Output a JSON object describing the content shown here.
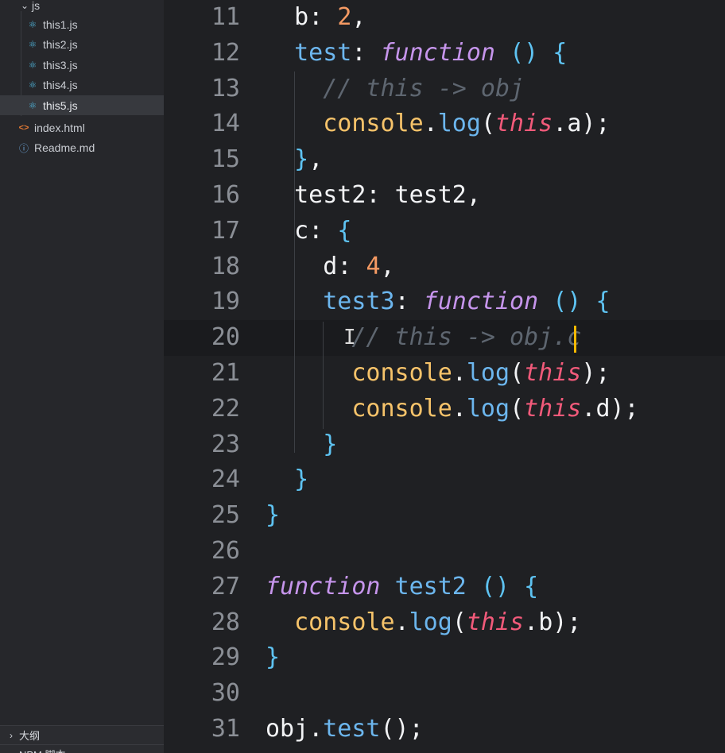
{
  "sidebar": {
    "folder": {
      "label": "js"
    },
    "files": [
      {
        "label": "this1.js",
        "icon": "react-icon",
        "active": false
      },
      {
        "label": "this2.js",
        "icon": "react-icon",
        "active": false
      },
      {
        "label": "this3.js",
        "icon": "react-icon",
        "active": false
      },
      {
        "label": "this4.js",
        "icon": "react-icon",
        "active": false
      },
      {
        "label": "this5.js",
        "icon": "react-icon",
        "active": true
      }
    ],
    "root_files": [
      {
        "label": "index.html",
        "icon": "html-icon"
      },
      {
        "label": "Readme.md",
        "icon": "info-icon"
      }
    ],
    "panels": [
      {
        "label": "大纲"
      },
      {
        "label": "NPM 脚本"
      }
    ]
  },
  "editor": {
    "current_line": 20,
    "lines": [
      {
        "num": "11",
        "tokens": [
          [
            "k",
            "  b"
          ],
          [
            "p",
            ": "
          ],
          [
            "n",
            "2"
          ],
          [
            "p",
            ","
          ]
        ]
      },
      {
        "num": "12",
        "tokens": [
          [
            "b",
            "  test"
          ],
          [
            "p",
            ": "
          ],
          [
            "f",
            "function"
          ],
          [
            "p",
            " "
          ],
          [
            "br",
            "()"
          ],
          [
            "p",
            " "
          ],
          [
            "br",
            "{"
          ]
        ]
      },
      {
        "num": "13",
        "tokens": [
          [
            "c",
            "    // this -> obj"
          ]
        ]
      },
      {
        "num": "14",
        "tokens": [
          [
            "o",
            "    console"
          ],
          [
            "p",
            "."
          ],
          [
            "b",
            "log"
          ],
          [
            "p",
            "("
          ],
          [
            "t",
            "this"
          ],
          [
            "p",
            "."
          ],
          [
            "k",
            "a"
          ],
          [
            "p",
            ");"
          ]
        ]
      },
      {
        "num": "15",
        "tokens": [
          [
            "br",
            "  }"
          ],
          [
            "p",
            ","
          ]
        ]
      },
      {
        "num": "16",
        "tokens": [
          [
            "k",
            "  test2"
          ],
          [
            "p",
            ": "
          ],
          [
            "k",
            "test2"
          ],
          [
            "p",
            ","
          ]
        ]
      },
      {
        "num": "17",
        "tokens": [
          [
            "k",
            "  c"
          ],
          [
            "p",
            ": "
          ],
          [
            "br",
            "{"
          ]
        ]
      },
      {
        "num": "18",
        "tokens": [
          [
            "k",
            "    d"
          ],
          [
            "p",
            ": "
          ],
          [
            "n",
            "4"
          ],
          [
            "p",
            ","
          ]
        ]
      },
      {
        "num": "19",
        "tokens": [
          [
            "b",
            "    test3"
          ],
          [
            "p",
            ": "
          ],
          [
            "f",
            "function"
          ],
          [
            "p",
            " "
          ],
          [
            "br",
            "()"
          ],
          [
            "p",
            " "
          ],
          [
            "br",
            "{"
          ]
        ]
      },
      {
        "num": "20",
        "tokens": [
          [
            "c",
            "      // this -> obj.c"
          ]
        ]
      },
      {
        "num": "21",
        "tokens": [
          [
            "o",
            "      console"
          ],
          [
            "p",
            "."
          ],
          [
            "b",
            "log"
          ],
          [
            "p",
            "("
          ],
          [
            "t",
            "this"
          ],
          [
            "p",
            ");"
          ]
        ]
      },
      {
        "num": "22",
        "tokens": [
          [
            "o",
            "      console"
          ],
          [
            "p",
            "."
          ],
          [
            "b",
            "log"
          ],
          [
            "p",
            "("
          ],
          [
            "t",
            "this"
          ],
          [
            "p",
            "."
          ],
          [
            "k",
            "d"
          ],
          [
            "p",
            ");"
          ]
        ]
      },
      {
        "num": "23",
        "tokens": [
          [
            "br",
            "    }"
          ]
        ]
      },
      {
        "num": "24",
        "tokens": [
          [
            "br",
            "  }"
          ]
        ]
      },
      {
        "num": "25",
        "tokens": [
          [
            "br",
            "}"
          ]
        ]
      },
      {
        "num": "26",
        "tokens": []
      },
      {
        "num": "27",
        "tokens": [
          [
            "f",
            "function"
          ],
          [
            "p",
            " "
          ],
          [
            "b",
            "test2"
          ],
          [
            "p",
            " "
          ],
          [
            "br",
            "()"
          ],
          [
            "p",
            " "
          ],
          [
            "br",
            "{"
          ]
        ]
      },
      {
        "num": "28",
        "tokens": [
          [
            "o",
            "  console"
          ],
          [
            "p",
            "."
          ],
          [
            "b",
            "log"
          ],
          [
            "p",
            "("
          ],
          [
            "t",
            "this"
          ],
          [
            "p",
            "."
          ],
          [
            "k",
            "b"
          ],
          [
            "p",
            ");"
          ]
        ]
      },
      {
        "num": "29",
        "tokens": [
          [
            "br",
            "}"
          ]
        ]
      },
      {
        "num": "30",
        "tokens": []
      },
      {
        "num": "31",
        "tokens": [
          [
            "k",
            "obj"
          ],
          [
            "p",
            "."
          ],
          [
            "b",
            "test"
          ],
          [
            "p",
            "();"
          ]
        ]
      }
    ]
  }
}
